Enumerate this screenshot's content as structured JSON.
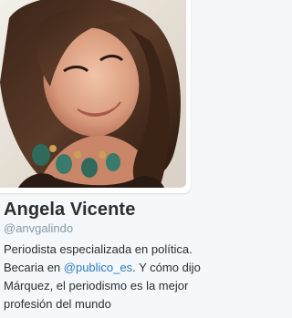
{
  "profile": {
    "avatar_icon": "profile-photo",
    "name": "Angela Vicente",
    "handle": "@anvgalindo",
    "bio": {
      "line1": "Periodista especializada en política.",
      "line2_prefix": "Becaria en ",
      "mention": "@publico_es",
      "line2_suffix": ". Y cómo dijo",
      "line3": "Márquez, el periodismo es la mejor",
      "line4": "profesión del mundo"
    }
  },
  "colors": {
    "background": "#f5f8fa",
    "name": "#292f33",
    "handle": "#8899a6",
    "link": "#2b7bb9"
  }
}
